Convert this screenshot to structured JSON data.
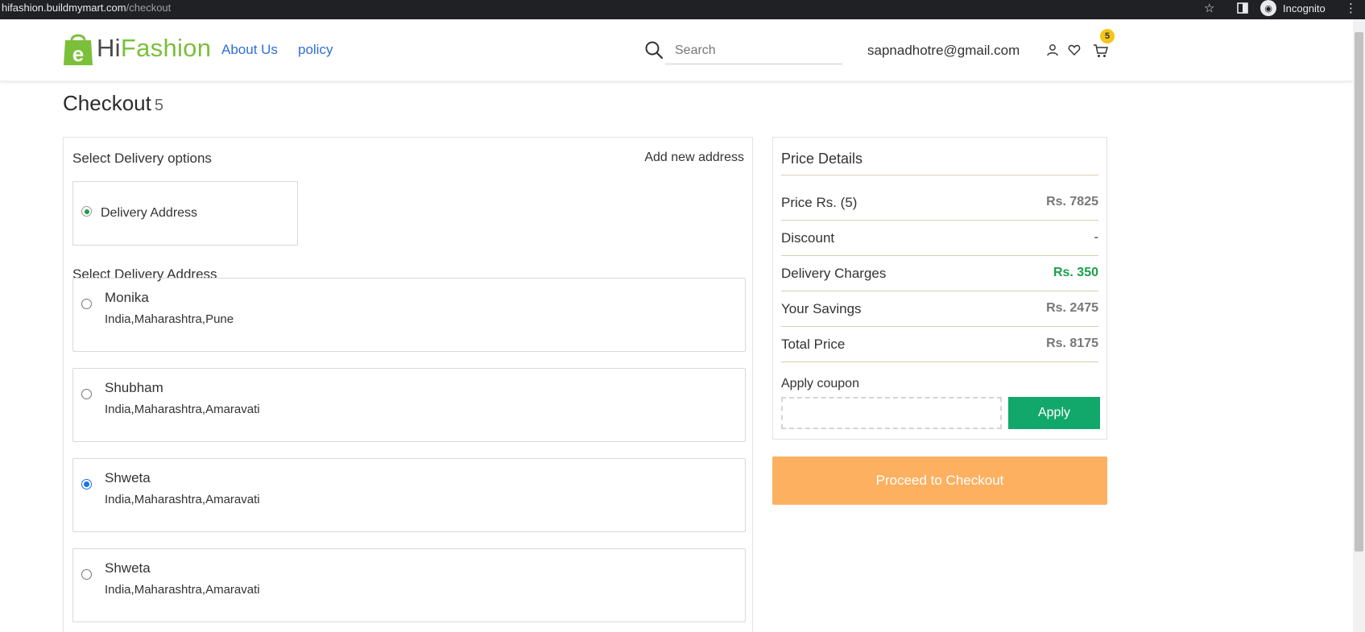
{
  "browser": {
    "url_domain": "hifashion.buildmymart.com",
    "url_path": "/checkout",
    "incognito_label": "Incognito"
  },
  "header": {
    "logo_letter": "e",
    "logo_text_hi": "Hi",
    "logo_text_fashion": "Fashion",
    "nav": [
      "About Us",
      "policy"
    ],
    "search_placeholder": "Search",
    "user_email": "sapnadhotre@gmail.com",
    "cart_count": "5"
  },
  "page": {
    "title": "Checkout",
    "title_count": "5"
  },
  "delivery": {
    "heading": "Select Delivery options",
    "add_new_address": "Add new address",
    "option_label": "Delivery Address",
    "address_heading": "Select Delivery Address",
    "addresses": [
      {
        "name": "Monika",
        "location": "India,Maharashtra,Pune",
        "selected": false
      },
      {
        "name": "Shubham",
        "location": "India,Maharashtra,Amaravati",
        "selected": false
      },
      {
        "name": "Shweta",
        "location": "India,Maharashtra,Amaravati",
        "selected": true
      },
      {
        "name": "Shweta",
        "location": "India,Maharashtra,Amaravati",
        "selected": false
      }
    ]
  },
  "price_details": {
    "heading": "Price Details",
    "rows": [
      {
        "label": "Price Rs. (5)",
        "value": "Rs. 7825"
      },
      {
        "label": "Discount",
        "value": "-"
      },
      {
        "label": "Delivery Charges",
        "value": "Rs. 350"
      },
      {
        "label": "Your Savings",
        "value": "Rs. 2475"
      },
      {
        "label": "Total Price",
        "value": "Rs. 8175"
      }
    ],
    "coupon_label": "Apply coupon",
    "coupon_value": "",
    "apply_label": "Apply",
    "proceed_label": "Proceed to Checkout"
  },
  "colors": {
    "accent_green": "#13a86b",
    "link_blue": "#2f6ed7",
    "proceed_orange": "#fcb060",
    "badge_yellow": "#f5c518"
  }
}
